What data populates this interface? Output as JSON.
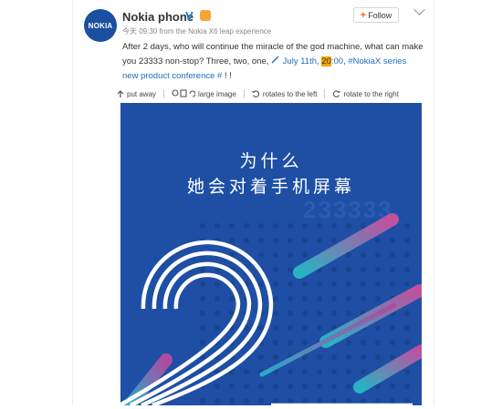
{
  "post": {
    "author": "Nokia phone",
    "verified_mark": "V",
    "avatar_text": "NOKIA",
    "time_label": "今天",
    "time": "09:30",
    "source": "from the Nokia X6 leap experience",
    "follow_label": "Follow",
    "text_part1": "After 2 days, who will continue the miracle of the god machine, what can make you 23333 non-stop? Three, two, one,",
    "link_date": "July 11th,",
    "link_hour": "20",
    "link_minutes": ":00,",
    "hashtag": "#NokiaX series new product conference #",
    "text_end": "! !"
  },
  "toolbar": {
    "put_away": "put away",
    "large_image": "large image",
    "rotate_left": "rotates to the left",
    "rotate_right": "rotate to the right"
  },
  "poster": {
    "line1": "为什么",
    "line2": "她会对着手机屏幕",
    "number": "233333",
    "bg_color": "#1e4fa5"
  },
  "colors": {
    "link": "#1e6fb8",
    "accent_orange": "#f7691d",
    "highlight": "#f6a400",
    "verified": "#1e7fd6"
  }
}
